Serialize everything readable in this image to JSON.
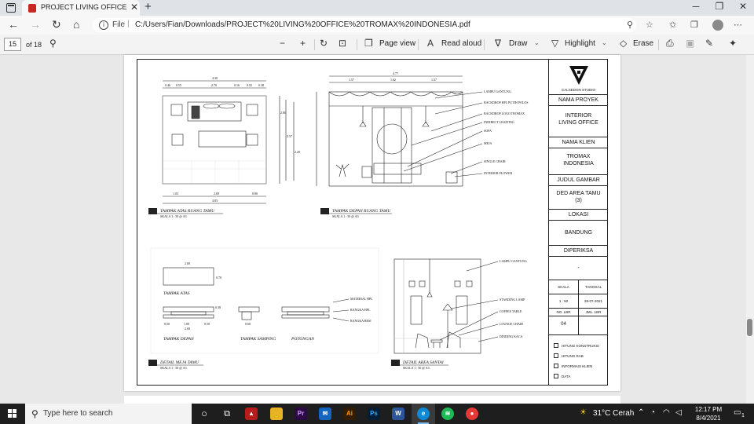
{
  "browser": {
    "tab_title": "PROJECT LIVING OFFICE TROMAX",
    "url_scheme": "File",
    "url": "C:/Users/Fian/Downloads/PROJECT%20LIVING%20OFFICE%20TROMAX%20INDONESIA.pdf"
  },
  "pdf_toolbar": {
    "page_number": "15",
    "page_total": "of 18",
    "page_view": "Page view",
    "read_aloud": "Read aloud",
    "draw": "Draw",
    "highlight": "Highlight",
    "erase": "Erase"
  },
  "title_block": {
    "studio": "CALSEDON STUDIO",
    "project_label": "NAMA PROYEK",
    "project_line1": "INTERIOR",
    "project_line2": "LIVING OFFICE",
    "client_label": "NAMA KLIEN",
    "client_line1": "TROMAX",
    "client_line2": "INDONESIA",
    "drawing_label": "JUDUL GAMBAR",
    "drawing_line1": "DED AREA TAMU",
    "drawing_line2": "(3)",
    "location_label": "LOKASI",
    "location": "BANDUNG",
    "checked_label": "DIPERIKSA",
    "checked_value": "-",
    "scale_label": "SKALA",
    "scale_value": "1 : 50",
    "date_label": "TANGGAL",
    "date_value": "28-07-2021",
    "sheet_label": "NO. LBR",
    "sheet_value": "04",
    "sheets_label": "JML. LBR",
    "checklist": [
      "HITUNG KONSTRUKSI",
      "HITUNG RAB",
      "INFORMASI KLIEN",
      "DATA"
    ]
  },
  "drawing": {
    "dims_top1": [
      "4.30",
      "0.46",
      "0.55",
      "2.70",
      "0.16",
      "0.55",
      "0.38"
    ],
    "dims_top2": [
      "4.77",
      "1.57",
      "1.62",
      "1.57"
    ],
    "dims_bottom1": [
      "1.03",
      "2.00",
      "0.80",
      "4.83"
    ],
    "elev_heights": [
      "2.80",
      "2.57",
      "2.20"
    ],
    "captions": [
      "TAMPAK ATAS RUANG TAMU",
      "TAMPAK DEPAN RUANG TAMU",
      "DETAIL MEJA TAMU",
      "DETAIL AREA SANTAI"
    ],
    "scale_note": "SKALA 1 : 50 @ A3",
    "elev_labels": [
      "LAMPU GANTUNG",
      "BACKDROP HPL PUTIH POLOS",
      "BACKDROP LOGO TROMAX",
      "INDIRECT LIGHTING",
      "SOFA",
      "MEJA",
      "SINGLE CHAIR",
      "INTERIOR FLOWER"
    ],
    "table_views": [
      "TAMPAK ATAS",
      "TAMPAK DEPAN",
      "TAMPAK SAMPING",
      "POTONGAN"
    ],
    "table_dims": [
      "2.00",
      "0.70",
      "0.50",
      "1.00",
      "0.50",
      "2.00",
      "0.60",
      "0.38"
    ],
    "table_labels": [
      "MATERIAL HPL",
      "RANGKA HPL",
      "RANGKA BESI"
    ],
    "santai_labels": [
      "LAMPU GANTUNG",
      "STANDING LAMP",
      "COFFEE TABLE",
      "LOUNGE CHAIR",
      "DINDING KACA"
    ]
  },
  "taskbar": {
    "search_placeholder": "Type here to search",
    "weather": "31°C Cerah",
    "time": "12:17 PM",
    "date": "8/4/2021",
    "notification_count": "1"
  }
}
